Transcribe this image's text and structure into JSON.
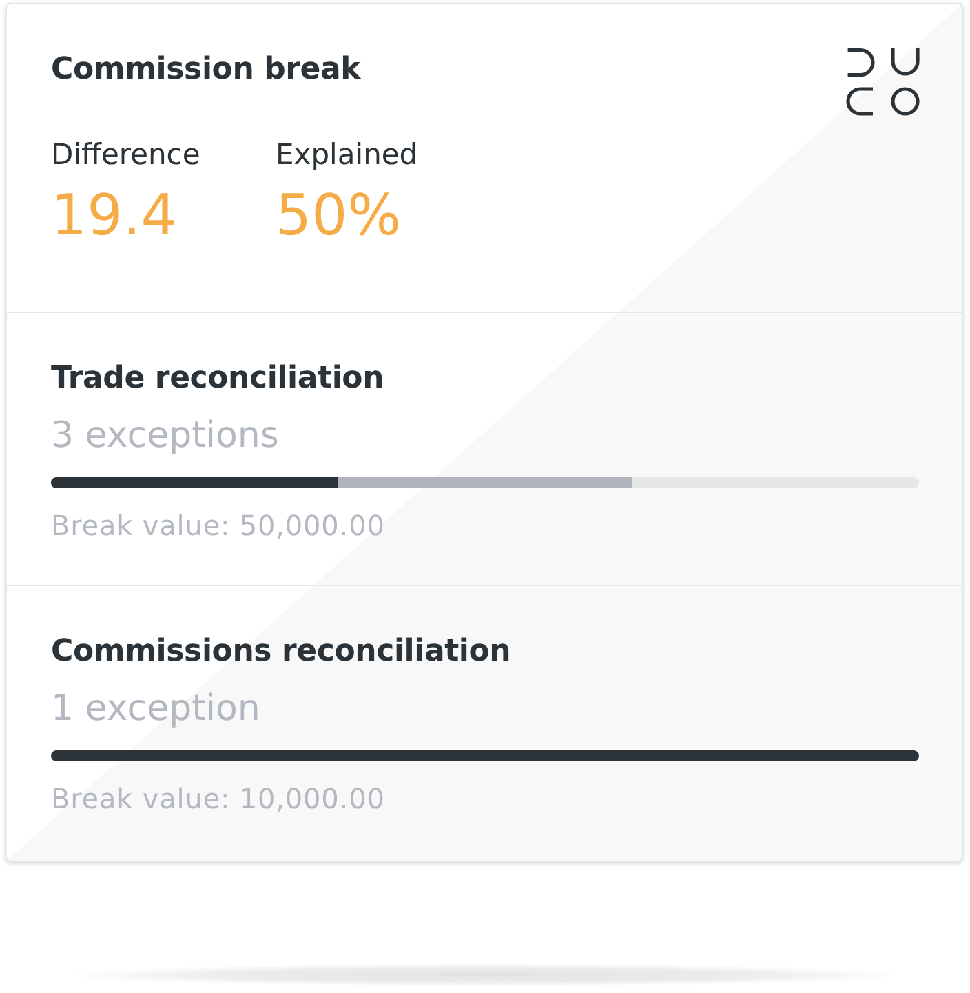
{
  "card": {
    "title": "Commission break",
    "metrics": [
      {
        "label": "Difference",
        "value": "19.4"
      },
      {
        "label": "Explained",
        "value": "50%"
      }
    ]
  },
  "sections": [
    {
      "title": "Trade reconciliation",
      "subtitle": "3 exceptions",
      "bar": {
        "segments": [
          {
            "level": 0.33,
            "color": "#2b3238"
          },
          {
            "level": 0.67,
            "color": "#aeb3bc"
          }
        ]
      },
      "break_value": "Break value: 50,000.00"
    },
    {
      "title": "Commissions reconciliation",
      "subtitle": "1 exception",
      "bar": {
        "segments": [
          {
            "level": 1,
            "color": "#2b3238"
          }
        ]
      },
      "break_value": "Break value: 10,000.00"
    }
  ]
}
